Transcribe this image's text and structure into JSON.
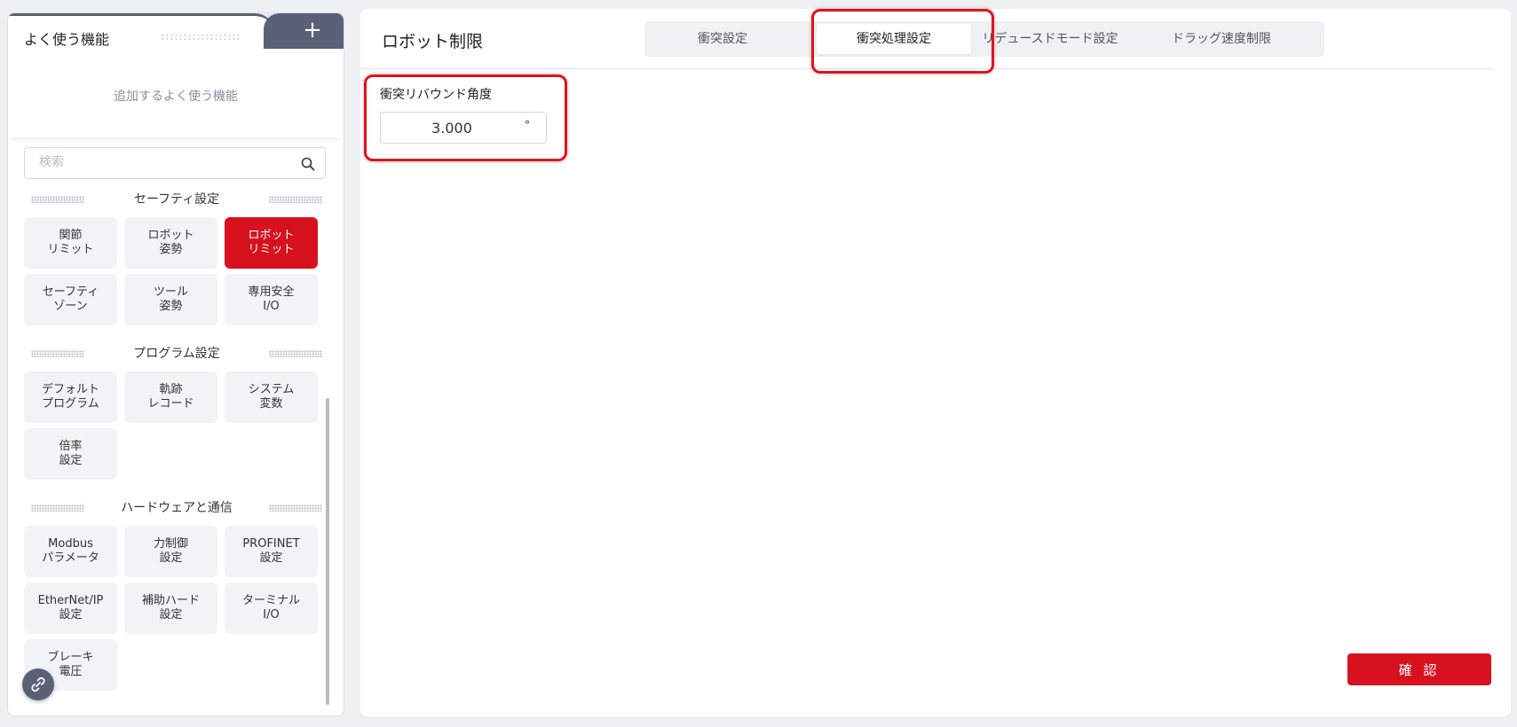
{
  "favorites": {
    "title": "よく使う機能",
    "add_label": "+",
    "empty_text": "追加するよく使う機能"
  },
  "search": {
    "placeholder": "検索",
    "value": ""
  },
  "sections": [
    {
      "title": "セーフティ設定",
      "items": [
        {
          "label": "関節\nリミット"
        },
        {
          "label": "ロボット\n姿勢"
        },
        {
          "label": "ロボット\nリミット"
        },
        {
          "label": "セーフティ\nゾーン"
        },
        {
          "label": "ツール\n姿勢"
        },
        {
          "label": "専用安全\nI/O"
        }
      ]
    },
    {
      "title": "プログラム設定",
      "items": [
        {
          "label": "デフォルト\nプログラム"
        },
        {
          "label": "軌跡\nレコード"
        },
        {
          "label": "システム\n変数"
        },
        {
          "label": "倍率\n設定"
        }
      ]
    },
    {
      "title": "ハードウェアと通信",
      "items": [
        {
          "label": "Modbus\nパラメータ"
        },
        {
          "label": "力制御\n設定"
        },
        {
          "label": "PROFINET\n設定"
        },
        {
          "label": "EtherNet/IP\n設定"
        },
        {
          "label": "補助ハード\n設定"
        },
        {
          "label": "ターミナル\nI/O"
        },
        {
          "label": "ブレーキ\n電圧"
        }
      ]
    }
  ],
  "main": {
    "title": "ロボット制限",
    "tabs": [
      {
        "label": "衝突設定"
      },
      {
        "label": "衝突処理設定"
      },
      {
        "label": "リデュースドモード設定"
      },
      {
        "label": "ドラッグ速度制限"
      }
    ],
    "field": {
      "label": "衝突リバウンド角度",
      "value": "3.000",
      "unit": "°"
    },
    "confirm_label": "確 認"
  },
  "colors": {
    "accent": "#d7111e",
    "sidebar_dark": "#5a6177",
    "highlight": "#e0141e"
  }
}
